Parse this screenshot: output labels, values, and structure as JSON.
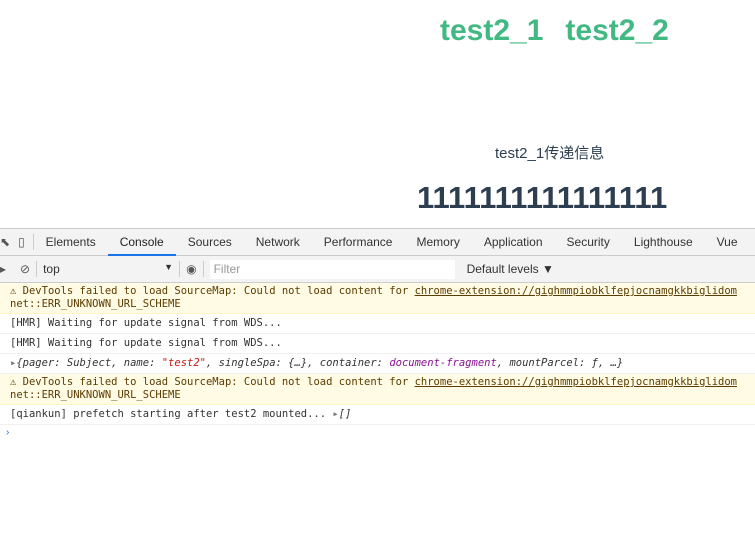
{
  "page": {
    "links": [
      "test2_1",
      "test2_2"
    ],
    "message": "test2_1传递信息",
    "value": "1111111111111111"
  },
  "devtools": {
    "tabs": [
      "Elements",
      "Console",
      "Sources",
      "Network",
      "Performance",
      "Memory",
      "Application",
      "Security",
      "Lighthouse",
      "Vue"
    ],
    "active_tab": "Console",
    "context": "top",
    "filter_placeholder": "Filter",
    "levels": "Default levels ▼",
    "logs": [
      {
        "type": "warn",
        "text": "DevTools failed to load SourceMap: Could not load content for ",
        "link": "chrome-extension://gighmmpiobklfepjocnamgkkbiglidom",
        "line2": "net::ERR_UNKNOWN_URL_SCHEME"
      },
      {
        "type": "log",
        "text": "[HMR] Waiting for update signal from WDS..."
      },
      {
        "type": "log",
        "text": "[HMR] Waiting for update signal from WDS..."
      },
      {
        "type": "object",
        "p1": "{pager: Subject, name: ",
        "p2": "\"test2\"",
        "p3": ", singleSpa: {…}, container: ",
        "p4": "document-fragment",
        "p5": ", mountParcel: ƒ, …}"
      },
      {
        "type": "warn",
        "text": "DevTools failed to load SourceMap: Could not load content for ",
        "link": "chrome-extension://gighmmpiobklfepjocnamgkkbiglidom",
        "line2": "net::ERR_UNKNOWN_URL_SCHEME"
      },
      {
        "type": "log",
        "text": "[qiankun] prefetch starting after test2 mounted... ",
        "extra": "[]"
      }
    ]
  }
}
